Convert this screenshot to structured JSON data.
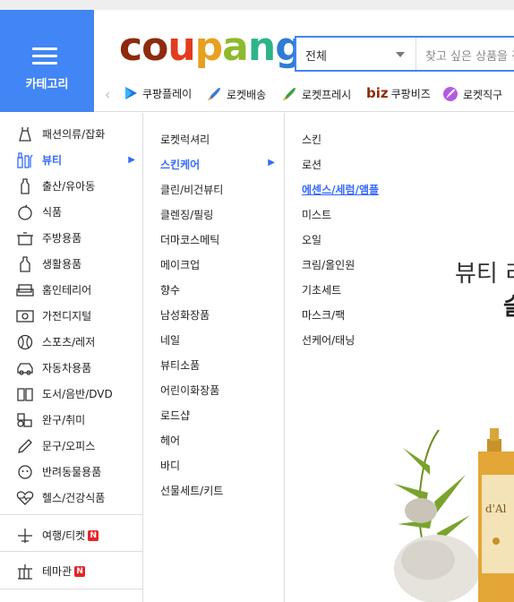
{
  "category_button": {
    "label": "카테고리"
  },
  "logo": {
    "text": "coupang"
  },
  "search": {
    "category": "전체",
    "placeholder": "찾고 싶은 상품을 검"
  },
  "shortcuts": [
    {
      "label": "쿠팡플레이",
      "icon": "play-icon"
    },
    {
      "label": "로켓배송",
      "icon": "rocket-icon"
    },
    {
      "label": "로켓프레시",
      "icon": "rocket-fresh-icon"
    },
    {
      "label": "쿠팡비즈",
      "prefix": "biz",
      "icon": "biz-logo"
    },
    {
      "label": "로켓직구",
      "icon": "rocket-global-icon"
    }
  ],
  "sidebar": {
    "items": [
      {
        "label": "패션의류/잡화",
        "icon": "dress-icon"
      },
      {
        "label": "뷰티",
        "icon": "cosmetics-icon",
        "active": true
      },
      {
        "label": "출산/유아동",
        "icon": "baby-bottle-icon"
      },
      {
        "label": "식품",
        "icon": "apple-icon"
      },
      {
        "label": "주방용품",
        "icon": "pot-icon"
      },
      {
        "label": "생활용품",
        "icon": "bottle-icon"
      },
      {
        "label": "홈인테리어",
        "icon": "sofa-icon"
      },
      {
        "label": "가전디지털",
        "icon": "tv-icon"
      },
      {
        "label": "스포츠/레저",
        "icon": "ball-icon"
      },
      {
        "label": "자동차용품",
        "icon": "car-icon"
      },
      {
        "label": "도서/음반/DVD",
        "icon": "book-icon"
      },
      {
        "label": "완구/취미",
        "icon": "toy-icon"
      },
      {
        "label": "문구/오피스",
        "icon": "pencil-icon"
      },
      {
        "label": "반려동물용품",
        "icon": "dog-icon"
      },
      {
        "label": "헬스/건강식품",
        "icon": "heart-pulse-icon"
      }
    ],
    "extra": [
      {
        "label": "여행/티켓",
        "icon": "airplane-icon",
        "badge": "N"
      },
      {
        "label": "테마관",
        "icon": "building-icon",
        "badge": "N"
      }
    ]
  },
  "beauty_menu": {
    "items": [
      "로켓럭셔리",
      "스킨케어",
      "클린/비건뷰티",
      "클렌징/필링",
      "더마코스메틱",
      "메이크업",
      "향수",
      "남성화장품",
      "네일",
      "뷰티소품",
      "어린이화장품",
      "로드샵",
      "헤어",
      "바디",
      "선물세트/키트"
    ],
    "active_index": 1
  },
  "skincare_menu": {
    "items": [
      "스킨",
      "로션",
      "에센스/세럼/앰플",
      "미스트",
      "오일",
      "크림/올인원",
      "기초세트",
      "마스크/팩",
      "선케어/태닝"
    ],
    "active_index": 2
  },
  "promo": {
    "line1": "뷰티 리",
    "line2": "슬"
  },
  "colors": {
    "accent": "#4285f4",
    "active_text": "#346aff",
    "badge": "#e52528"
  }
}
